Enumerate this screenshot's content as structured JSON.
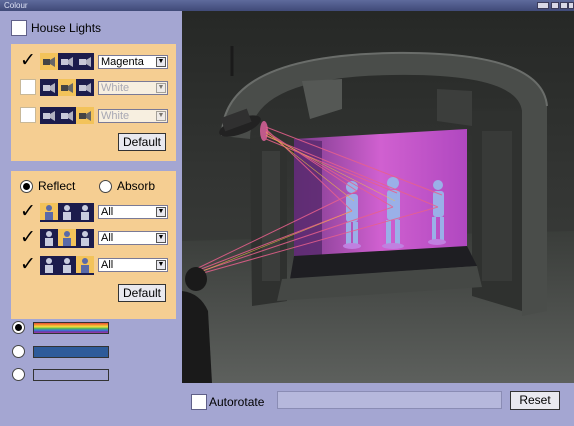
{
  "window": {
    "title": "Colour"
  },
  "house_lights": {
    "label": "House Lights",
    "checked": false
  },
  "lights": {
    "rows": [
      {
        "checked": true,
        "selected_icon": 0,
        "colour": "Magenta",
        "enabled": true
      },
      {
        "checked": false,
        "selected_icon": 1,
        "colour": "White",
        "enabled": false
      },
      {
        "checked": false,
        "selected_icon": 2,
        "colour": "White",
        "enabled": false
      }
    ],
    "default_label": "Default"
  },
  "mode": {
    "reflect_label": "Reflect",
    "absorb_label": "Absorb",
    "selected": "reflect"
  },
  "figures": {
    "rows": [
      {
        "checked": true,
        "selected_icon": 0,
        "value": "All"
      },
      {
        "checked": true,
        "selected_icon": 1,
        "value": "All"
      },
      {
        "checked": true,
        "selected_icon": 2,
        "value": "All"
      }
    ],
    "default_label": "Default"
  },
  "display_options": {
    "selected": 0,
    "swatches": [
      "spectrum",
      "#2e5b9a",
      "#a4a6d2"
    ]
  },
  "bottom": {
    "autorotate_label": "Autorotate",
    "autorotate_checked": false,
    "reset_label": "Reset"
  },
  "colors": {
    "panel_bg": "#a4a6d2",
    "group_bg": "#f5ce92",
    "icon_bg": "#1c1c4c",
    "icon_selected": "#f3c35a",
    "beam": "#e8608c"
  }
}
